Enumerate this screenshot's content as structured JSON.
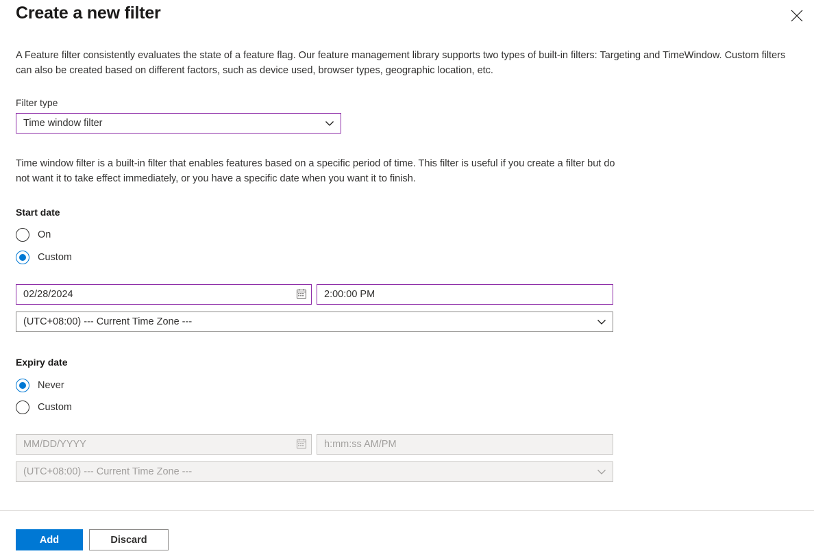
{
  "dialog": {
    "title": "Create a new filter",
    "close_icon": "close-icon",
    "intro": "A Feature filter consistently evaluates the state of a feature flag. Our feature management library supports two types of built-in filters: Targeting and TimeWindow. Custom filters can also be created based on different factors, such as device used, browser types, geographic location, etc."
  },
  "filter_type": {
    "label": "Filter type",
    "value": "Time window filter",
    "chevron_icon": "chevron-down-icon"
  },
  "filter_description": "Time window filter is a built-in filter that enables features based on a specific period of time. This filter is useful if you create a filter but do not want it to take effect immediately, or you have a specific date when you want it to finish.",
  "start_date": {
    "label": "Start date",
    "options": [
      {
        "label": "On",
        "checked": false
      },
      {
        "label": "Custom",
        "checked": true
      }
    ],
    "date": {
      "value": "02/28/2024",
      "placeholder": "MM/DD/YYYY",
      "icon": "calendar-icon"
    },
    "time": {
      "value": "2:00:00 PM",
      "placeholder": "h:mm:ss AM/PM"
    },
    "timezone": {
      "value": "(UTC+08:00) --- Current Time Zone ---",
      "chevron_icon": "chevron-down-icon"
    }
  },
  "expiry_date": {
    "label": "Expiry date",
    "options": [
      {
        "label": "Never",
        "checked": true
      },
      {
        "label": "Custom",
        "checked": false
      }
    ],
    "date": {
      "value": "",
      "placeholder": "MM/DD/YYYY",
      "icon": "calendar-icon"
    },
    "time": {
      "value": "",
      "placeholder": "h:mm:ss AM/PM"
    },
    "timezone": {
      "value": "(UTC+08:00) --- Current Time Zone ---",
      "chevron_icon": "chevron-down-icon"
    }
  },
  "footer": {
    "add_label": "Add",
    "discard_label": "Discard"
  },
  "colors": {
    "accent_blue": "#0078d4",
    "dirty_purple": "#8e2da8",
    "border_gray": "#8a8886",
    "disabled_bg": "#f3f2f1",
    "text": "#323130"
  }
}
